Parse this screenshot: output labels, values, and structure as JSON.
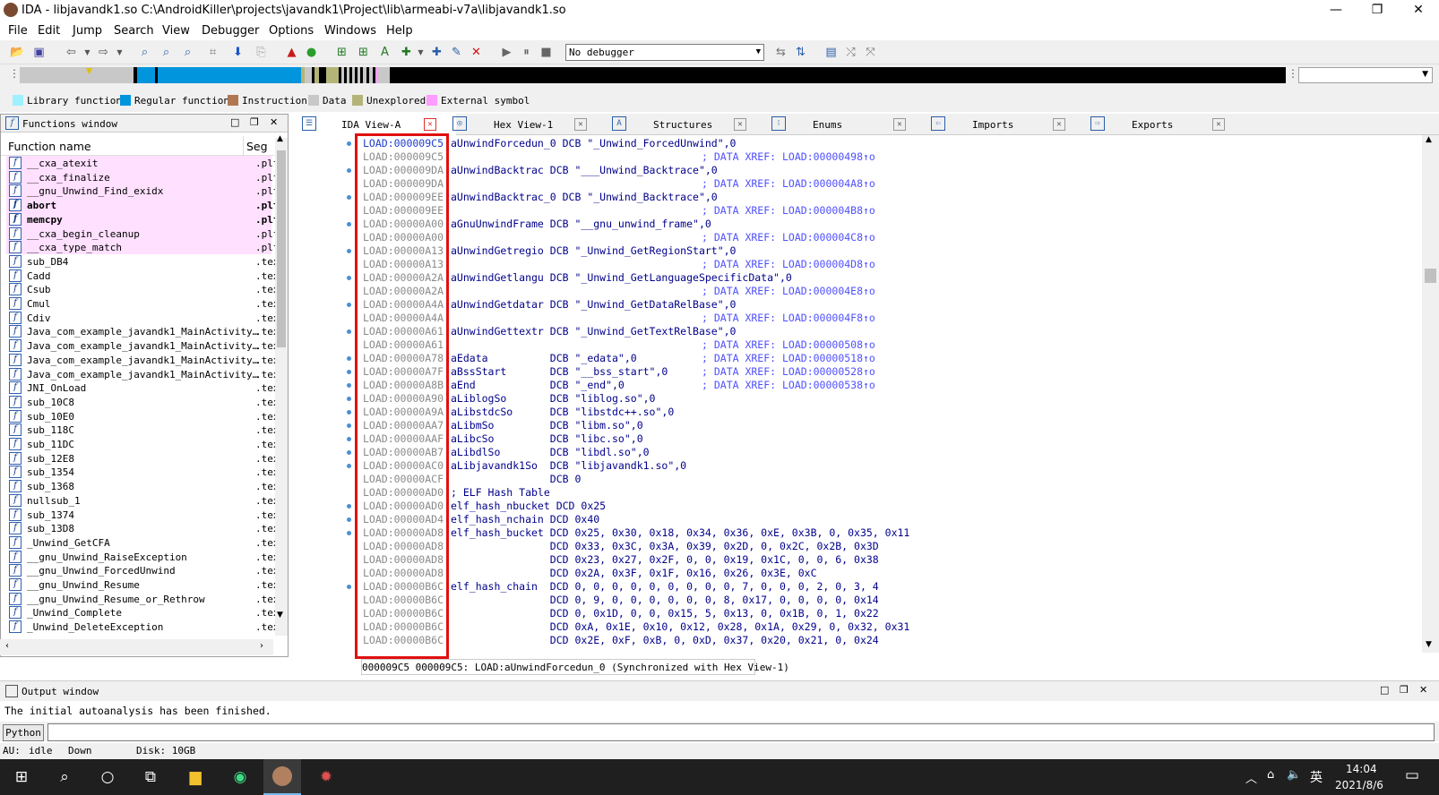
{
  "window": {
    "title": "IDA - libjavandk1.so C:\\AndroidKiller\\projects\\javandk1\\Project\\lib\\armeabi-v7a\\libjavandk1.so",
    "minimize": "—",
    "maximize": "❐",
    "close": "✕"
  },
  "menu": [
    "File",
    "Edit",
    "Jump",
    "Search",
    "View",
    "Debugger",
    "Options",
    "Windows",
    "Help"
  ],
  "toolbar": {
    "debugger_select": "No debugger"
  },
  "legend": [
    {
      "label": "Library function",
      "color": "#a0f0ff"
    },
    {
      "label": "Regular function",
      "color": "#0095dc"
    },
    {
      "label": "Instruction",
      "color": "#b07850"
    },
    {
      "label": "Data",
      "color": "#c8c8c8"
    },
    {
      "label": "Unexplored",
      "color": "#b4b478"
    },
    {
      "label": "External symbol",
      "color": "#ff9cff"
    }
  ],
  "functions_window": {
    "title": "Functions window",
    "col_name": "Function name",
    "col_seg": "Seg",
    "rows": [
      {
        "name": "__cxa_atexit",
        "seg": ".plt",
        "lib": true,
        "bold": false
      },
      {
        "name": "__cxa_finalize",
        "seg": ".plt",
        "lib": true,
        "bold": false
      },
      {
        "name": "__gnu_Unwind_Find_exidx",
        "seg": ".plt",
        "lib": true,
        "bold": false
      },
      {
        "name": "abort",
        "seg": ".plt",
        "lib": true,
        "bold": true
      },
      {
        "name": "memcpy",
        "seg": ".plt",
        "lib": true,
        "bold": true
      },
      {
        "name": "__cxa_begin_cleanup",
        "seg": ".plt",
        "lib": true,
        "bold": false
      },
      {
        "name": "__cxa_type_match",
        "seg": ".plt",
        "lib": true,
        "bold": false
      },
      {
        "name": "sub_DB4",
        "seg": ".tex",
        "lib": false,
        "bold": false
      },
      {
        "name": "Cadd",
        "seg": ".tex",
        "lib": false,
        "bold": false
      },
      {
        "name": "Csub",
        "seg": ".tex",
        "lib": false,
        "bold": false
      },
      {
        "name": "Cmul",
        "seg": ".tex",
        "lib": false,
        "bold": false
      },
      {
        "name": "Cdiv",
        "seg": ".tex",
        "lib": false,
        "bold": false
      },
      {
        "name": "Java_com_example_javandk1_MainActivity…",
        "seg": ".tex",
        "lib": false,
        "bold": false
      },
      {
        "name": "Java_com_example_javandk1_MainActivity…",
        "seg": ".tex",
        "lib": false,
        "bold": false
      },
      {
        "name": "Java_com_example_javandk1_MainActivity…",
        "seg": ".tex",
        "lib": false,
        "bold": false
      },
      {
        "name": "Java_com_example_javandk1_MainActivity…",
        "seg": ".tex",
        "lib": false,
        "bold": false
      },
      {
        "name": "JNI_OnLoad",
        "seg": ".tex",
        "lib": false,
        "bold": false
      },
      {
        "name": "sub_10C8",
        "seg": ".tex",
        "lib": false,
        "bold": false
      },
      {
        "name": "sub_10E0",
        "seg": ".tex",
        "lib": false,
        "bold": false
      },
      {
        "name": "sub_118C",
        "seg": ".tex",
        "lib": false,
        "bold": false
      },
      {
        "name": "sub_11DC",
        "seg": ".tex",
        "lib": false,
        "bold": false
      },
      {
        "name": "sub_12E8",
        "seg": ".tex",
        "lib": false,
        "bold": false
      },
      {
        "name": "sub_1354",
        "seg": ".tex",
        "lib": false,
        "bold": false
      },
      {
        "name": "sub_1368",
        "seg": ".tex",
        "lib": false,
        "bold": false
      },
      {
        "name": "nullsub_1",
        "seg": ".tex",
        "lib": false,
        "bold": false
      },
      {
        "name": "sub_1374",
        "seg": ".tex",
        "lib": false,
        "bold": false
      },
      {
        "name": "sub_13D8",
        "seg": ".tex",
        "lib": false,
        "bold": false
      },
      {
        "name": "_Unwind_GetCFA",
        "seg": ".tex",
        "lib": false,
        "bold": false
      },
      {
        "name": "__gnu_Unwind_RaiseException",
        "seg": ".tex",
        "lib": false,
        "bold": false
      },
      {
        "name": "__gnu_Unwind_ForcedUnwind",
        "seg": ".tex",
        "lib": false,
        "bold": false
      },
      {
        "name": "__gnu_Unwind_Resume",
        "seg": ".tex",
        "lib": false,
        "bold": false
      },
      {
        "name": "__gnu_Unwind_Resume_or_Rethrow",
        "seg": ".tex",
        "lib": false,
        "bold": false
      },
      {
        "name": "_Unwind_Complete",
        "seg": ".tex",
        "lib": false,
        "bold": false
      },
      {
        "name": "_Unwind_DeleteException",
        "seg": ".tex",
        "lib": false,
        "bold": false
      }
    ]
  },
  "tabs": [
    {
      "label": "IDA View-A",
      "icon": "☰",
      "active": true
    },
    {
      "label": "Hex View-1",
      "icon": "◎",
      "active": false
    },
    {
      "label": "Structures",
      "icon": "A",
      "active": false
    },
    {
      "label": "Enums",
      "icon": "⁝",
      "active": false
    },
    {
      "label": "Imports",
      "icon": "⇦",
      "active": false
    },
    {
      "label": "Exports",
      "icon": "⇨",
      "active": false
    }
  ],
  "code": [
    {
      "addr": "LOAD:000009C5",
      "body": "aUnwindForcedun_0 DCB \"_Unwind_ForcedUnwind\",0",
      "comment": "",
      "dot": true
    },
    {
      "addr": "LOAD:000009C5",
      "body": "",
      "comment": "; DATA XREF: LOAD:00000498↑o",
      "dot": false
    },
    {
      "addr": "LOAD:000009DA",
      "body": "aUnwindBacktrac DCB \"___Unwind_Backtrace\",0",
      "comment": "",
      "dot": true
    },
    {
      "addr": "LOAD:000009DA",
      "body": "",
      "comment": "; DATA XREF: LOAD:000004A8↑o",
      "dot": false
    },
    {
      "addr": "LOAD:000009EE",
      "body": "aUnwindBacktrac_0 DCB \"_Unwind_Backtrace\",0",
      "comment": "",
      "dot": true
    },
    {
      "addr": "LOAD:000009EE",
      "body": "",
      "comment": "; DATA XREF: LOAD:000004B8↑o",
      "dot": false
    },
    {
      "addr": "LOAD:00000A00",
      "body": "aGnuUnwindFrame DCB \"__gnu_unwind_frame\",0",
      "comment": "",
      "dot": true
    },
    {
      "addr": "LOAD:00000A00",
      "body": "",
      "comment": "; DATA XREF: LOAD:000004C8↑o",
      "dot": false
    },
    {
      "addr": "LOAD:00000A13",
      "body": "aUnwindGetregio DCB \"_Unwind_GetRegionStart\",0",
      "comment": "",
      "dot": true
    },
    {
      "addr": "LOAD:00000A13",
      "body": "",
      "comment": "; DATA XREF: LOAD:000004D8↑o",
      "dot": false
    },
    {
      "addr": "LOAD:00000A2A",
      "body": "aUnwindGetlangu DCB \"_Unwind_GetLanguageSpecificData\",0",
      "comment": "",
      "dot": true
    },
    {
      "addr": "LOAD:00000A2A",
      "body": "",
      "comment": "; DATA XREF: LOAD:000004E8↑o",
      "dot": false
    },
    {
      "addr": "LOAD:00000A4A",
      "body": "aUnwindGetdatar DCB \"_Unwind_GetDataRelBase\",0",
      "comment": "",
      "dot": true
    },
    {
      "addr": "LOAD:00000A4A",
      "body": "",
      "comment": "; DATA XREF: LOAD:000004F8↑o",
      "dot": false
    },
    {
      "addr": "LOAD:00000A61",
      "body": "aUnwindGettextr DCB \"_Unwind_GetTextRelBase\",0",
      "comment": "",
      "dot": true
    },
    {
      "addr": "LOAD:00000A61",
      "body": "",
      "comment": "; DATA XREF: LOAD:00000508↑o",
      "dot": false
    },
    {
      "addr": "LOAD:00000A78",
      "body": "aEdata          DCB \"_edata\",0",
      "comment": "; DATA XREF: LOAD:00000518↑o",
      "dot": true
    },
    {
      "addr": "LOAD:00000A7F",
      "body": "aBssStart       DCB \"__bss_start\",0",
      "comment": "; DATA XREF: LOAD:00000528↑o",
      "dot": true
    },
    {
      "addr": "LOAD:00000A8B",
      "body": "aEnd            DCB \"_end\",0",
      "comment": "; DATA XREF: LOAD:00000538↑o",
      "dot": true
    },
    {
      "addr": "LOAD:00000A90",
      "body": "aLiblogSo       DCB \"liblog.so\",0",
      "comment": "",
      "dot": true
    },
    {
      "addr": "LOAD:00000A9A",
      "body": "aLibstdcSo      DCB \"libstdc++.so\",0",
      "comment": "",
      "dot": true
    },
    {
      "addr": "LOAD:00000AA7",
      "body": "aLibmSo         DCB \"libm.so\",0",
      "comment": "",
      "dot": true
    },
    {
      "addr": "LOAD:00000AAF",
      "body": "aLibcSo         DCB \"libc.so\",0",
      "comment": "",
      "dot": true
    },
    {
      "addr": "LOAD:00000AB7",
      "body": "aLibdlSo        DCB \"libdl.so\",0",
      "comment": "",
      "dot": true
    },
    {
      "addr": "LOAD:00000AC0",
      "body": "aLibjavandk1So  DCB \"libjavandk1.so\",0",
      "comment": "",
      "dot": true
    },
    {
      "addr": "LOAD:00000ACF",
      "body": "                DCB 0",
      "comment": "",
      "dot": false
    },
    {
      "addr": "LOAD:00000AD0",
      "body": "; ELF Hash Table",
      "comment": "",
      "dot": false
    },
    {
      "addr": "LOAD:00000AD0",
      "body": "elf_hash_nbucket DCD 0x25",
      "comment": "",
      "dot": true
    },
    {
      "addr": "LOAD:00000AD4",
      "body": "elf_hash_nchain DCD 0x40",
      "comment": "",
      "dot": true
    },
    {
      "addr": "LOAD:00000AD8",
      "body": "elf_hash_bucket DCD 0x25, 0x30, 0x18, 0x34, 0x36, 0xE, 0x3B, 0, 0x35, 0x11",
      "comment": "",
      "dot": true
    },
    {
      "addr": "LOAD:00000AD8",
      "body": "                DCD 0x33, 0x3C, 0x3A, 0x39, 0x2D, 0, 0x2C, 0x2B, 0x3D",
      "comment": "",
      "dot": false
    },
    {
      "addr": "LOAD:00000AD8",
      "body": "                DCD 0x23, 0x27, 0x2F, 0, 0, 0x19, 0x1C, 0, 0, 6, 0x38",
      "comment": "",
      "dot": false
    },
    {
      "addr": "LOAD:00000AD8",
      "body": "                DCD 0x2A, 0x3F, 0x1F, 0x16, 0x26, 0x3E, 0xC",
      "comment": "",
      "dot": false
    },
    {
      "addr": "LOAD:00000B6C",
      "body": "elf_hash_chain  DCD 0, 0, 0, 0, 0, 0, 0, 0, 0, 7, 0, 0, 0, 2, 0, 3, 4",
      "comment": "",
      "dot": true
    },
    {
      "addr": "LOAD:00000B6C",
      "body": "                DCD 0, 9, 0, 0, 0, 0, 0, 0, 8, 0x17, 0, 0, 0, 0, 0x14",
      "comment": "",
      "dot": false
    },
    {
      "addr": "LOAD:00000B6C",
      "body": "                DCD 0, 0x1D, 0, 0, 0x15, 5, 0x13, 0, 0x1B, 0, 1, 0x22",
      "comment": "",
      "dot": false
    },
    {
      "addr": "LOAD:00000B6C",
      "body": "                DCD 0xA, 0x1E, 0x10, 0x12, 0x28, 0x1A, 0x29, 0, 0x32, 0x31",
      "comment": "",
      "dot": false
    },
    {
      "addr": "LOAD:00000B6C",
      "body": "                DCD 0x2E, 0xF, 0xB, 0, 0xD, 0x37, 0x20, 0x21, 0, 0x24",
      "comment": "",
      "dot": false
    }
  ],
  "status_line": "000009C5 000009C5: LOAD:aUnwindForcedun_0 (Synchronized with Hex View-1)",
  "output": {
    "title": "Output window",
    "message": "The initial autoanalysis has been finished.",
    "python_button": "Python"
  },
  "au_bar": {
    "au": "AU:",
    "state": "idle",
    "direction": "Down",
    "disk": "Disk: 10GB"
  },
  "taskbar": {
    "time": "14:04",
    "date": "2021/8/6",
    "ime": "英"
  }
}
